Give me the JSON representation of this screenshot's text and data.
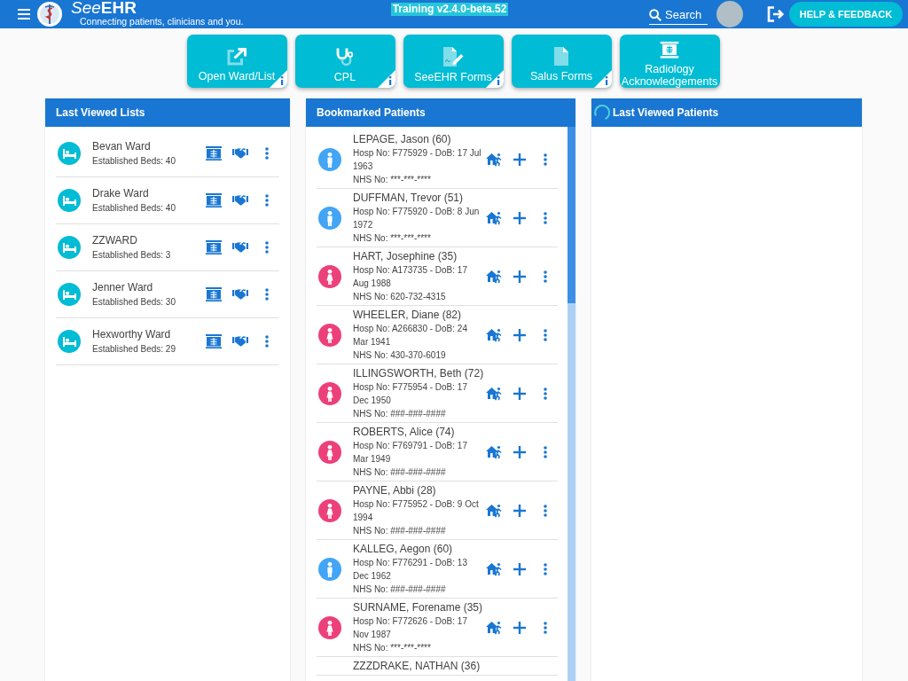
{
  "header": {
    "brand": "See**EHR**",
    "tagline": "Connecting patients, clinicians and you.",
    "environment": "Training v2.4.0-beta.52",
    "search": {
      "placeholder": "Search"
    },
    "help_button": "HELP & FEEDBACK"
  },
  "tiles": [
    {
      "label": "Open Ward/List",
      "kind": "open-list",
      "info": true
    },
    {
      "label": "CPL",
      "kind": "stethoscope",
      "info": true
    },
    {
      "label": "SeeEHR Forms",
      "kind": "signed-form",
      "info": true
    },
    {
      "label": "Salus Forms",
      "kind": "form",
      "info": true
    },
    {
      "label": "Radiology Acknowledgements",
      "kind": "radiology",
      "info": false
    }
  ],
  "last_viewed_lists": {
    "title": "Last Viewed Lists",
    "items": [
      {
        "name": "Bevan Ward",
        "detail": "Established Beds: 40"
      },
      {
        "name": "Drake Ward",
        "detail": "Established Beds: 40"
      },
      {
        "name": "ZZWARD",
        "detail": "Established Beds: 3"
      },
      {
        "name": "Jenner Ward",
        "detail": "Established Beds: 30"
      },
      {
        "name": "Hexworthy Ward",
        "detail": "Established Beds: 29"
      }
    ]
  },
  "bookmarked_patients": {
    "title": "Bookmarked Patients",
    "items": [
      {
        "name": "LEPAGE, Jason (60)",
        "hosp": "Hosp No: F775929 - DoB: 17 Jul 1963",
        "nhs": "NHS No: ***-***-****",
        "kind": "male",
        "color": "#42a5f5"
      },
      {
        "name": "DUFFMAN, Trevor (51)",
        "hosp": "Hosp No: F775920 - DoB: 8 Jun 1972",
        "nhs": "NHS No: ***-***-****",
        "kind": "male",
        "color": "#42a5f5"
      },
      {
        "name": "HART, Josephine (35)",
        "hosp": "Hosp No: A173735 - DoB: 17 Aug 1988",
        "nhs": "NHS No: 620-732-4315",
        "kind": "female",
        "color": "#ec407a"
      },
      {
        "name": "WHEELER, Diane (82)",
        "hosp": "Hosp No: A266830 - DoB: 24 Mar 1941",
        "nhs": "NHS No: 430-370-6019",
        "kind": "female",
        "color": "#ec407a"
      },
      {
        "name": "ILLINGSWORTH, Beth (72)",
        "hosp": "Hosp No: F775954 - DoB: 17 Dec 1950",
        "nhs": "NHS No: ###-###-####",
        "kind": "female",
        "color": "#ec407a"
      },
      {
        "name": "ROBERTS, Alice (74)",
        "hosp": "Hosp No: F769791 - DoB: 17 Mar 1949",
        "nhs": "NHS No: ###-###-####",
        "kind": "female",
        "color": "#ec407a"
      },
      {
        "name": "PAYNE, Abbi (28)",
        "hosp": "Hosp No: F775952 - DoB: 9 Oct 1994",
        "nhs": "NHS No: ###-###-####",
        "kind": "female",
        "color": "#ec407a"
      },
      {
        "name": "KALLEG, Aegon (60)",
        "hosp": "Hosp No: F776291 - DoB: 13 Dec 1962",
        "nhs": "NHS No: ###-###-####",
        "kind": "male",
        "color": "#42a5f5"
      },
      {
        "name": "SURNAME, Forename (35)",
        "hosp": "Hosp No: F772626 - DoB: 17 Nov 1987",
        "nhs": "NHS No: ***-***-****",
        "kind": "female",
        "color": "#ec407a"
      },
      {
        "name": "ZZZDRAKE, NATHAN (36)"
      }
    ]
  },
  "last_viewed_patients": {
    "title": "Last Viewed Patients",
    "loading": true
  }
}
